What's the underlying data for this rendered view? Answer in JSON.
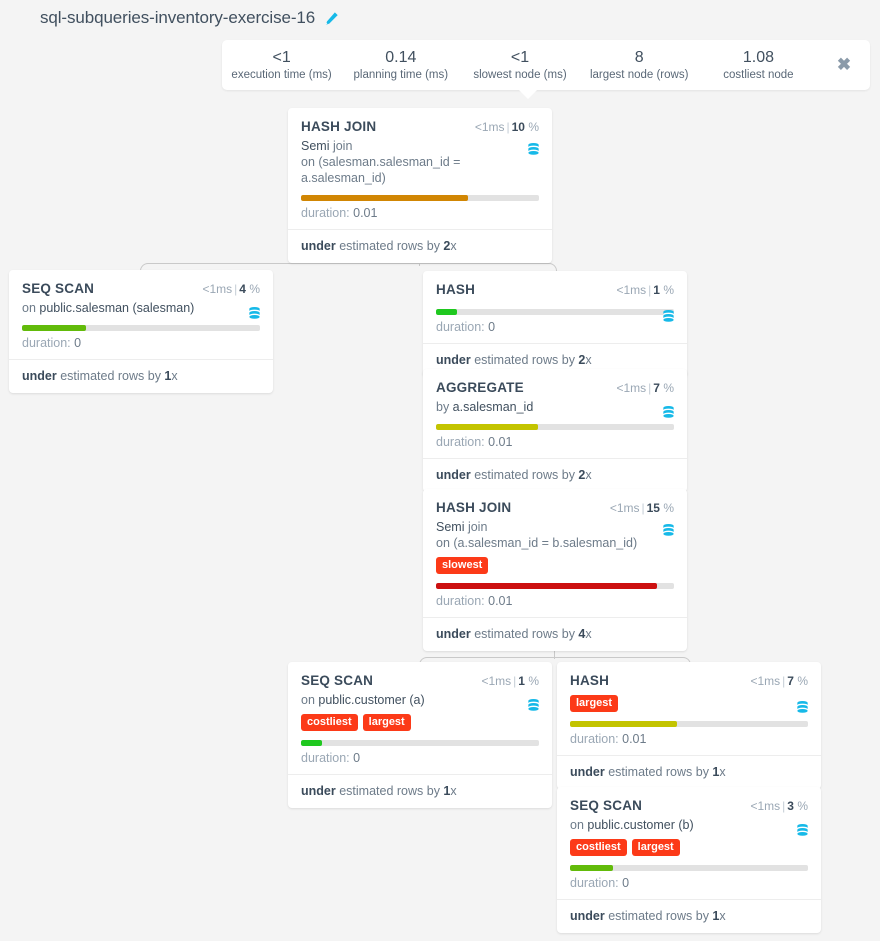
{
  "header": {
    "title": "sql-subqueries-inventory-exercise-16",
    "edit_icon": "pencil-icon",
    "close_label": "✖"
  },
  "summary": {
    "stats": [
      {
        "value": "<1",
        "label": "execution time (ms)"
      },
      {
        "value": "0.14",
        "label": "planning time (ms)"
      },
      {
        "value": "<1",
        "label": "slowest node (ms)"
      },
      {
        "value": "8",
        "label": "largest node (rows)"
      },
      {
        "value": "1.08",
        "label": "costliest node"
      }
    ]
  },
  "colors": {
    "badge": "#fc3a18",
    "bar_orange": "#d18603",
    "bar_green_light": "#62bb0a",
    "bar_green_bright": "#1fc81f",
    "bar_yellow": "#c3c400",
    "bar_red": "#cc1010",
    "bar_track": "#e2e2e2",
    "db_icon": "#16b9e8",
    "pencil_icon": "#16b9e8"
  },
  "nodes": [
    {
      "id": "hash-join-root",
      "type": "HASH JOIN",
      "time": "<1ms",
      "percent": "10",
      "percent_unit": "%",
      "detail_prefix": "Semi",
      "detail_rest": " join",
      "detail_line2": "on (salesman.salesman_id = a.salesman_id)",
      "badges": [],
      "bar_fill_pct": 70,
      "bar_color": "#d18603",
      "duration_label": "duration: ",
      "duration_value": "0.01",
      "footer_bold": "under",
      "footer_text": " estimated rows by ",
      "footer_factor": "2",
      "footer_suffix": "x",
      "db_icon": "database-icon"
    },
    {
      "id": "seq-scan-salesman",
      "type": "SEQ SCAN",
      "time": "<1ms",
      "percent": "4",
      "percent_unit": "%",
      "detail_prefix": "on",
      "detail_rest": " public.salesman (salesman)",
      "detail_line2": "",
      "badges": [],
      "bar_fill_pct": 27,
      "bar_color": "#62bb0a",
      "duration_label": "duration: ",
      "duration_value": "0",
      "footer_bold": "under",
      "footer_text": " estimated rows by ",
      "footer_factor": "1",
      "footer_suffix": "x",
      "db_icon": "database-icon"
    },
    {
      "id": "hash-upper",
      "type": "HASH",
      "time": "<1ms",
      "percent": "1",
      "percent_unit": "%",
      "detail_prefix": "",
      "detail_rest": "",
      "detail_line2": "",
      "badges": [],
      "bar_fill_pct": 9,
      "bar_color": "#1fc81f",
      "duration_label": "duration: ",
      "duration_value": "0",
      "footer_bold": "under",
      "footer_text": " estimated rows by ",
      "footer_factor": "2",
      "footer_suffix": "x",
      "db_icon": "database-icon"
    },
    {
      "id": "aggregate",
      "type": "AGGREGATE",
      "time": "<1ms",
      "percent": "7",
      "percent_unit": "%",
      "detail_prefix": "by",
      "detail_rest": " a.salesman_id",
      "detail_line2": "",
      "badges": [],
      "bar_fill_pct": 43,
      "bar_color": "#c3c400",
      "duration_label": "duration: ",
      "duration_value": "0.01",
      "footer_bold": "under",
      "footer_text": " estimated rows by ",
      "footer_factor": "2",
      "footer_suffix": "x",
      "db_icon": "database-icon"
    },
    {
      "id": "hash-join-inner",
      "type": "HASH JOIN",
      "time": "<1ms",
      "percent": "15",
      "percent_unit": "%",
      "detail_prefix": "Semi",
      "detail_rest": " join",
      "detail_line2": "on (a.salesman_id = b.salesman_id)",
      "badges": [
        "slowest"
      ],
      "bar_fill_pct": 93,
      "bar_color": "#cc1010",
      "duration_label": "duration: ",
      "duration_value": "0.01",
      "footer_bold": "under",
      "footer_text": " estimated rows by ",
      "footer_factor": "4",
      "footer_suffix": "x",
      "db_icon": "database-icon"
    },
    {
      "id": "seq-scan-customer-a",
      "type": "SEQ SCAN",
      "time": "<1ms",
      "percent": "1",
      "percent_unit": "%",
      "detail_prefix": "on",
      "detail_rest": " public.customer (a)",
      "detail_line2": "",
      "badges": [
        "costliest",
        "largest"
      ],
      "bar_fill_pct": 9,
      "bar_color": "#1fc81f",
      "duration_label": "duration: ",
      "duration_value": "0",
      "footer_bold": "under",
      "footer_text": " estimated rows by ",
      "footer_factor": "1",
      "footer_suffix": "x",
      "db_icon": "database-icon"
    },
    {
      "id": "hash-lower",
      "type": "HASH",
      "time": "<1ms",
      "percent": "7",
      "percent_unit": "%",
      "detail_prefix": "",
      "detail_rest": "",
      "detail_line2": "",
      "badges": [
        "largest"
      ],
      "bar_fill_pct": 45,
      "bar_color": "#c3c400",
      "duration_label": "duration: ",
      "duration_value": "0.01",
      "footer_bold": "under",
      "footer_text": " estimated rows by ",
      "footer_factor": "1",
      "footer_suffix": "x",
      "db_icon": "database-icon"
    },
    {
      "id": "seq-scan-customer-b",
      "type": "SEQ SCAN",
      "time": "<1ms",
      "percent": "3",
      "percent_unit": "%",
      "detail_prefix": "on",
      "detail_rest": " public.customer (b)",
      "detail_line2": "",
      "badges": [
        "costliest",
        "largest"
      ],
      "bar_fill_pct": 18,
      "bar_color": "#62bb0a",
      "duration_label": "duration: ",
      "duration_value": "0",
      "footer_bold": "under",
      "footer_text": " estimated rows by ",
      "footer_factor": "1",
      "footer_suffix": "x",
      "db_icon": "database-icon"
    }
  ]
}
